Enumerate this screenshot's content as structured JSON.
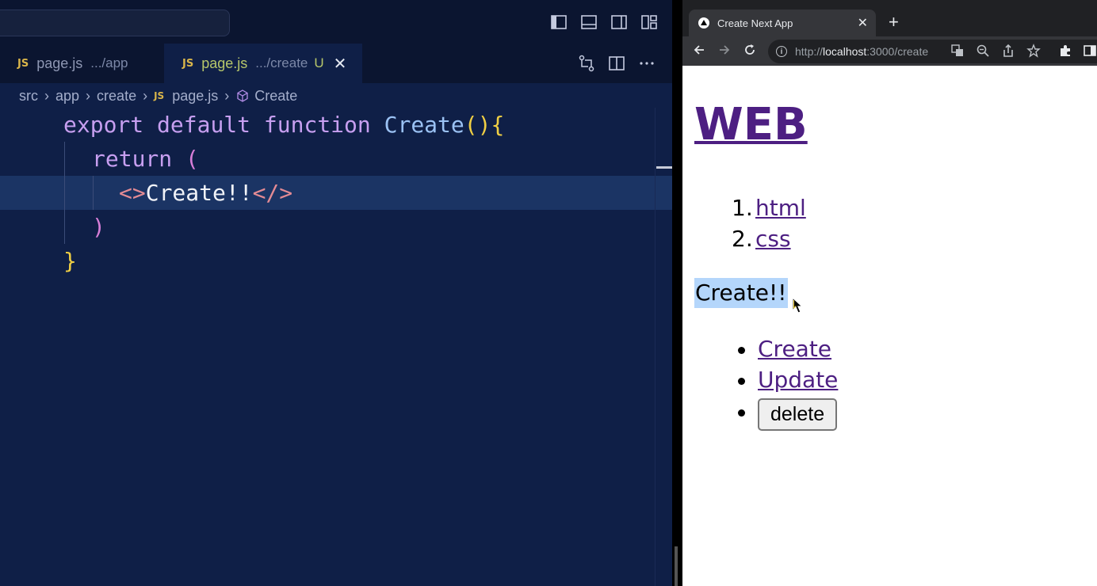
{
  "vscode": {
    "tabs": [
      {
        "icon": "JS",
        "name": "page.js",
        "path": ".../app"
      },
      {
        "icon": "JS",
        "name": "page.js",
        "path": ".../create",
        "status": "U",
        "close": "✕"
      }
    ],
    "breadcrumb": [
      "src",
      "app",
      "create",
      "page.js",
      "Create"
    ],
    "breadcrumb_js": "JS",
    "code": {
      "l1": {
        "kw1": "export",
        "kw2": "default",
        "kw3": "function",
        "name": "Create",
        "paren": "()",
        "brace": "{"
      },
      "l2": {
        "kw": "return",
        "paren": "("
      },
      "l3": {
        "open": "<>",
        "text": "Create!!",
        "close": "</>"
      },
      "l4": {
        "paren": ")"
      },
      "l5": {
        "brace": "}"
      }
    }
  },
  "browser": {
    "tab_title": "Create Next App",
    "tab_close": "✕",
    "new_tab": "+",
    "url_prefix": "http://",
    "url_host": "localhost",
    "url_rest": ":3000/create",
    "page": {
      "title": "WEB",
      "ordered": [
        {
          "num": "1.",
          "label": "html"
        },
        {
          "num": "2.",
          "label": "css"
        }
      ],
      "content": "Create!!",
      "links": [
        "Create",
        "Update"
      ],
      "delete_label": "delete"
    }
  }
}
